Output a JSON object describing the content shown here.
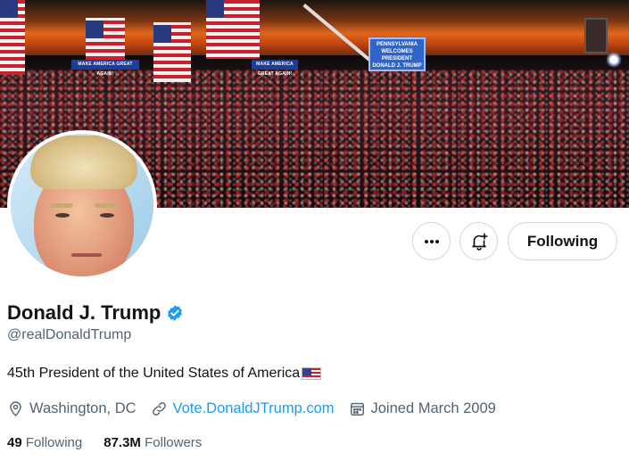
{
  "banner": {
    "sign_left": "MAKE AMERICA GREAT AGAIN!",
    "sign_right": "MAKE AMERICA GREAT AGAIN!",
    "jumbotron": "PENNSYLVANIA WELCOMES PRESIDENT DONALD J. TRUMP"
  },
  "actions": {
    "more_icon": "more-horizontal-icon",
    "notify_icon": "bell-plus-icon",
    "following_label": "Following"
  },
  "profile": {
    "name": "Donald J. Trump",
    "verified_icon": "verified-badge-icon",
    "handle": "@realDonaldTrump",
    "bio": "45th President of the United States of America",
    "location": "Washington, DC",
    "website": "Vote.DonaldJTrump.com",
    "joined": "Joined March 2009"
  },
  "stats": {
    "following_count": "49",
    "following_label": "Following",
    "followers_count": "87.3M",
    "followers_label": "Followers"
  },
  "colors": {
    "accent": "#1d9bf0",
    "secondary_text": "#536471",
    "border": "#cfd9de"
  }
}
